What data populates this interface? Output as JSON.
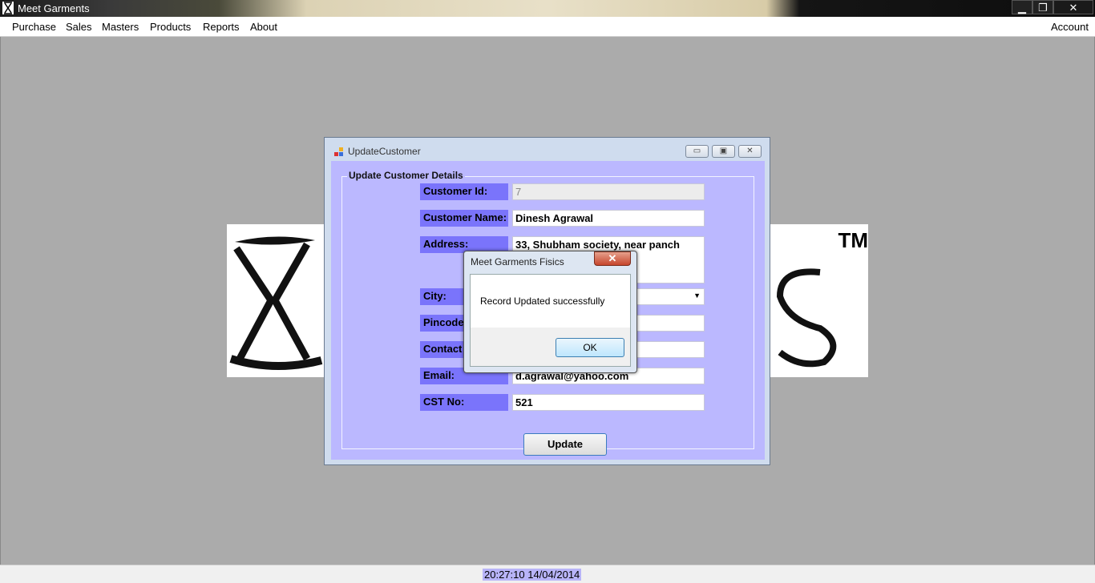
{
  "window": {
    "title": "Meet Garments",
    "minimize": "▁",
    "restore": "❐",
    "close": "✕"
  },
  "menu": {
    "items": [
      "Purchase",
      "Sales",
      "Masters",
      "Products",
      "Reports",
      "About"
    ],
    "account": "Account"
  },
  "logo": {
    "tm": "TM"
  },
  "update_customer": {
    "title": "UpdateCustomer",
    "group_title": "Update Customer Details",
    "fields": {
      "customer_id": {
        "label": "Customer Id:",
        "value": "7"
      },
      "customer_name": {
        "label": "Customer Name:",
        "value": "Dinesh Agrawal"
      },
      "address": {
        "label": "Address:",
        "value": "33, Shubham society, near panch kuva"
      },
      "city": {
        "label": "City:",
        "value": ""
      },
      "pincode": {
        "label": "Pincode:",
        "value": ""
      },
      "contact_no": {
        "label": "Contact No:",
        "value": ""
      },
      "email": {
        "label": "Email:",
        "value": "d.agrawal@yahoo.com"
      },
      "cst_no": {
        "label": "CST No:",
        "value": "521"
      }
    },
    "update_button": "Update"
  },
  "message_box": {
    "title": "Meet Garments Fisics",
    "close": "✕",
    "message": "Record Updated successfully",
    "ok": "OK"
  },
  "status_bar": {
    "clock": "20:27:10 14/04/2014"
  }
}
